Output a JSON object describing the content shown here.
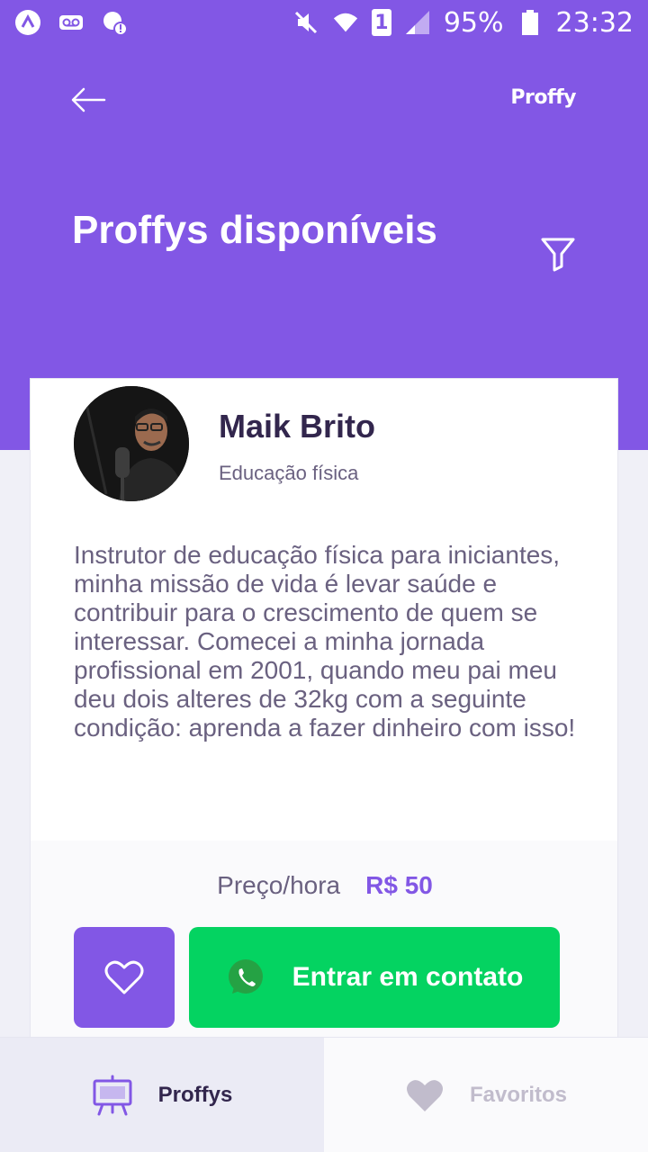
{
  "statusbar": {
    "battery": "95%",
    "time": "23:32",
    "sim": "1"
  },
  "header": {
    "logo": "Proffy",
    "title": "Proffys disponíveis"
  },
  "teacher": {
    "name": "Maik Brito",
    "subject": "Educação física",
    "bio": "Instrutor de educação física para iniciantes, minha missão de vida é levar saúde e contribuir para o crescimento de quem se interessar. Comecei a minha jornada profissional em 2001, quando meu pai meu deu dois alteres de 32kg com a seguinte condição: aprenda a fazer dinheiro com isso!",
    "price_label": "Preço/hora",
    "price_value": "R$ 50",
    "contact_label": "Entrar em contato"
  },
  "tabs": [
    {
      "label": "Proffys",
      "icon": "easel-icon"
    },
    {
      "label": "Favoritos",
      "icon": "heart-icon"
    }
  ],
  "colors": {
    "primary": "#8257E5",
    "green": "#04D361",
    "background": "#F0F0F7"
  }
}
